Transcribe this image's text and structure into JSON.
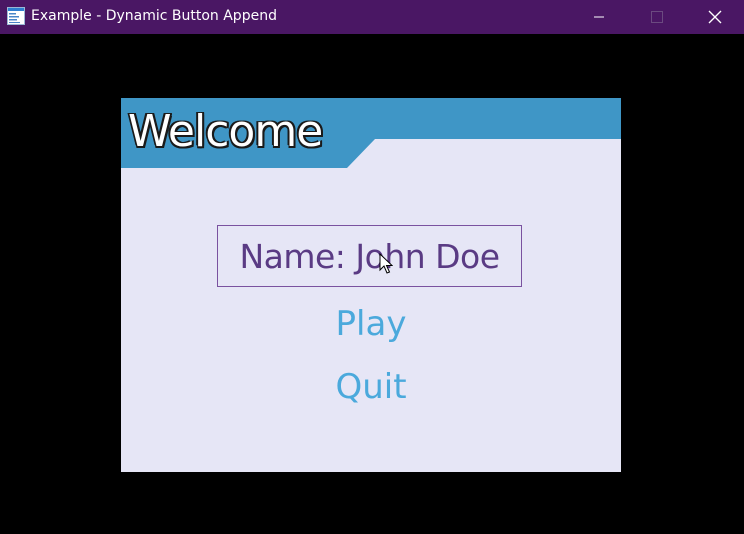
{
  "window": {
    "title": "Example - Dynamic Button Append",
    "app_icon": "app-window-icon",
    "controls": [
      "minimize-icon",
      "maximize-icon",
      "close-icon"
    ]
  },
  "colors": {
    "titlebar": "#4a1764",
    "panel_bg": "#e6e6f6",
    "header_band": "#3f96c6",
    "name_text": "#5a3b84",
    "menu_text": "#4ba9dc"
  },
  "panel": {
    "heading": "Welcome",
    "name_label": "Name: John Doe",
    "buttons": {
      "play": "Play",
      "quit": "Quit"
    }
  }
}
